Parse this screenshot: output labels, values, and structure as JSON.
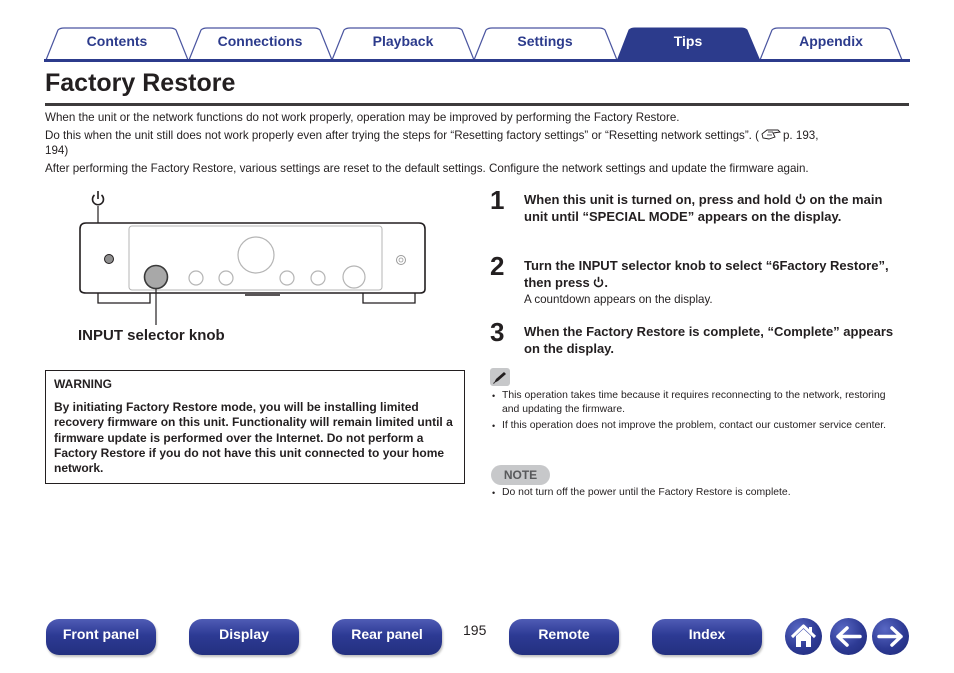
{
  "tabs": [
    {
      "label": "Contents",
      "active": false
    },
    {
      "label": "Connections",
      "active": false
    },
    {
      "label": "Playback",
      "active": false
    },
    {
      "label": "Settings",
      "active": false
    },
    {
      "label": "Tips",
      "active": true
    },
    {
      "label": "Appendix",
      "active": false
    }
  ],
  "colors": {
    "brand": "#2c3b8c",
    "tab_active_bg": "#2c3b8c",
    "tab_border": "#4a55a0",
    "note_badge": "#c7c8ca"
  },
  "page": {
    "title": "Factory Restore",
    "intro": [
      "When the unit or the network functions do not work properly, operation may be improved by performing the Factory Restore.",
      "Do this when the unit still does not work properly even after trying the steps for “Resetting factory settings” or “Resetting network settings”. (",
      "p. 193,",
      "194)",
      "After performing the Factory Restore, various settings are reset to the default settings. Configure the network settings and update the firmware again."
    ],
    "reference_icon": "page-reference-icon"
  },
  "diagram": {
    "power_symbol_icon": "power-icon",
    "knob_label": "INPUT selector knob"
  },
  "warning": {
    "title": "WARNING",
    "body": "By initiating Factory Restore mode, you will be installing limited recovery firmware on this unit. Functionality will remain limited until a firmware update is performed over the Internet. Do not perform a Factory Restore if you do not have this unit connected to your home network."
  },
  "steps": [
    {
      "num": "1",
      "text_a": "When this unit is turned on, press and hold ",
      "text_b": " on the main unit until “SPECIAL MODE” appears on the display.",
      "sub": ""
    },
    {
      "num": "2",
      "text_a": "Turn the INPUT selector knob to select “6Factory Restore”, then press ",
      "text_b": ".",
      "sub": "A countdown appears on the display."
    },
    {
      "num": "3",
      "text_a": "When the Factory Restore is complete, “Complete” appears on the display.",
      "text_b": "",
      "sub": ""
    }
  ],
  "memo": {
    "icon": "pencil-icon",
    "bullets": [
      "This operation takes time because it requires reconnecting to the network, restoring and updating the firmware.",
      "If this operation does not improve the problem, contact our customer service center."
    ]
  },
  "note": {
    "badge": "NOTE",
    "bullets": [
      "Do not turn off the power until the Factory Restore is complete."
    ]
  },
  "footer": {
    "buttons": [
      "Front panel",
      "Display",
      "Rear panel",
      "Remote",
      "Index"
    ],
    "page_number": "195",
    "icons": [
      "home-icon",
      "back-arrow-icon",
      "forward-arrow-icon"
    ]
  }
}
